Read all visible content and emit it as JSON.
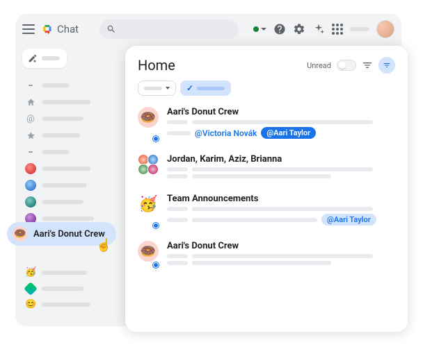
{
  "app": {
    "name": "Chat"
  },
  "topbar": {
    "search_placeholder": "Search"
  },
  "hover_chip": {
    "label": "Aari's Donut Crew"
  },
  "panel": {
    "title": "Home",
    "unread_label": "Unread"
  },
  "conversations": [
    {
      "id": "donut1",
      "title": "Aari's Donut Crew",
      "avatar_type": "donut",
      "has_badge": true,
      "mentions": [
        {
          "text": "@Victoria Novák",
          "style": "link"
        },
        {
          "text": "@Aari Taylor",
          "style": "pill"
        }
      ]
    },
    {
      "id": "group",
      "title": "Jordan, Karim, Aziz, Brianna",
      "avatar_type": "group",
      "has_badge": false,
      "mentions": []
    },
    {
      "id": "team",
      "title": "Team Announcements",
      "avatar_type": "party",
      "has_badge": true,
      "mentions": [
        {
          "text": "@Aari Taylor",
          "style": "light"
        }
      ]
    },
    {
      "id": "donut2",
      "title": "Aari's Donut Crew",
      "avatar_type": "donut",
      "has_badge": true,
      "mentions": []
    }
  ]
}
